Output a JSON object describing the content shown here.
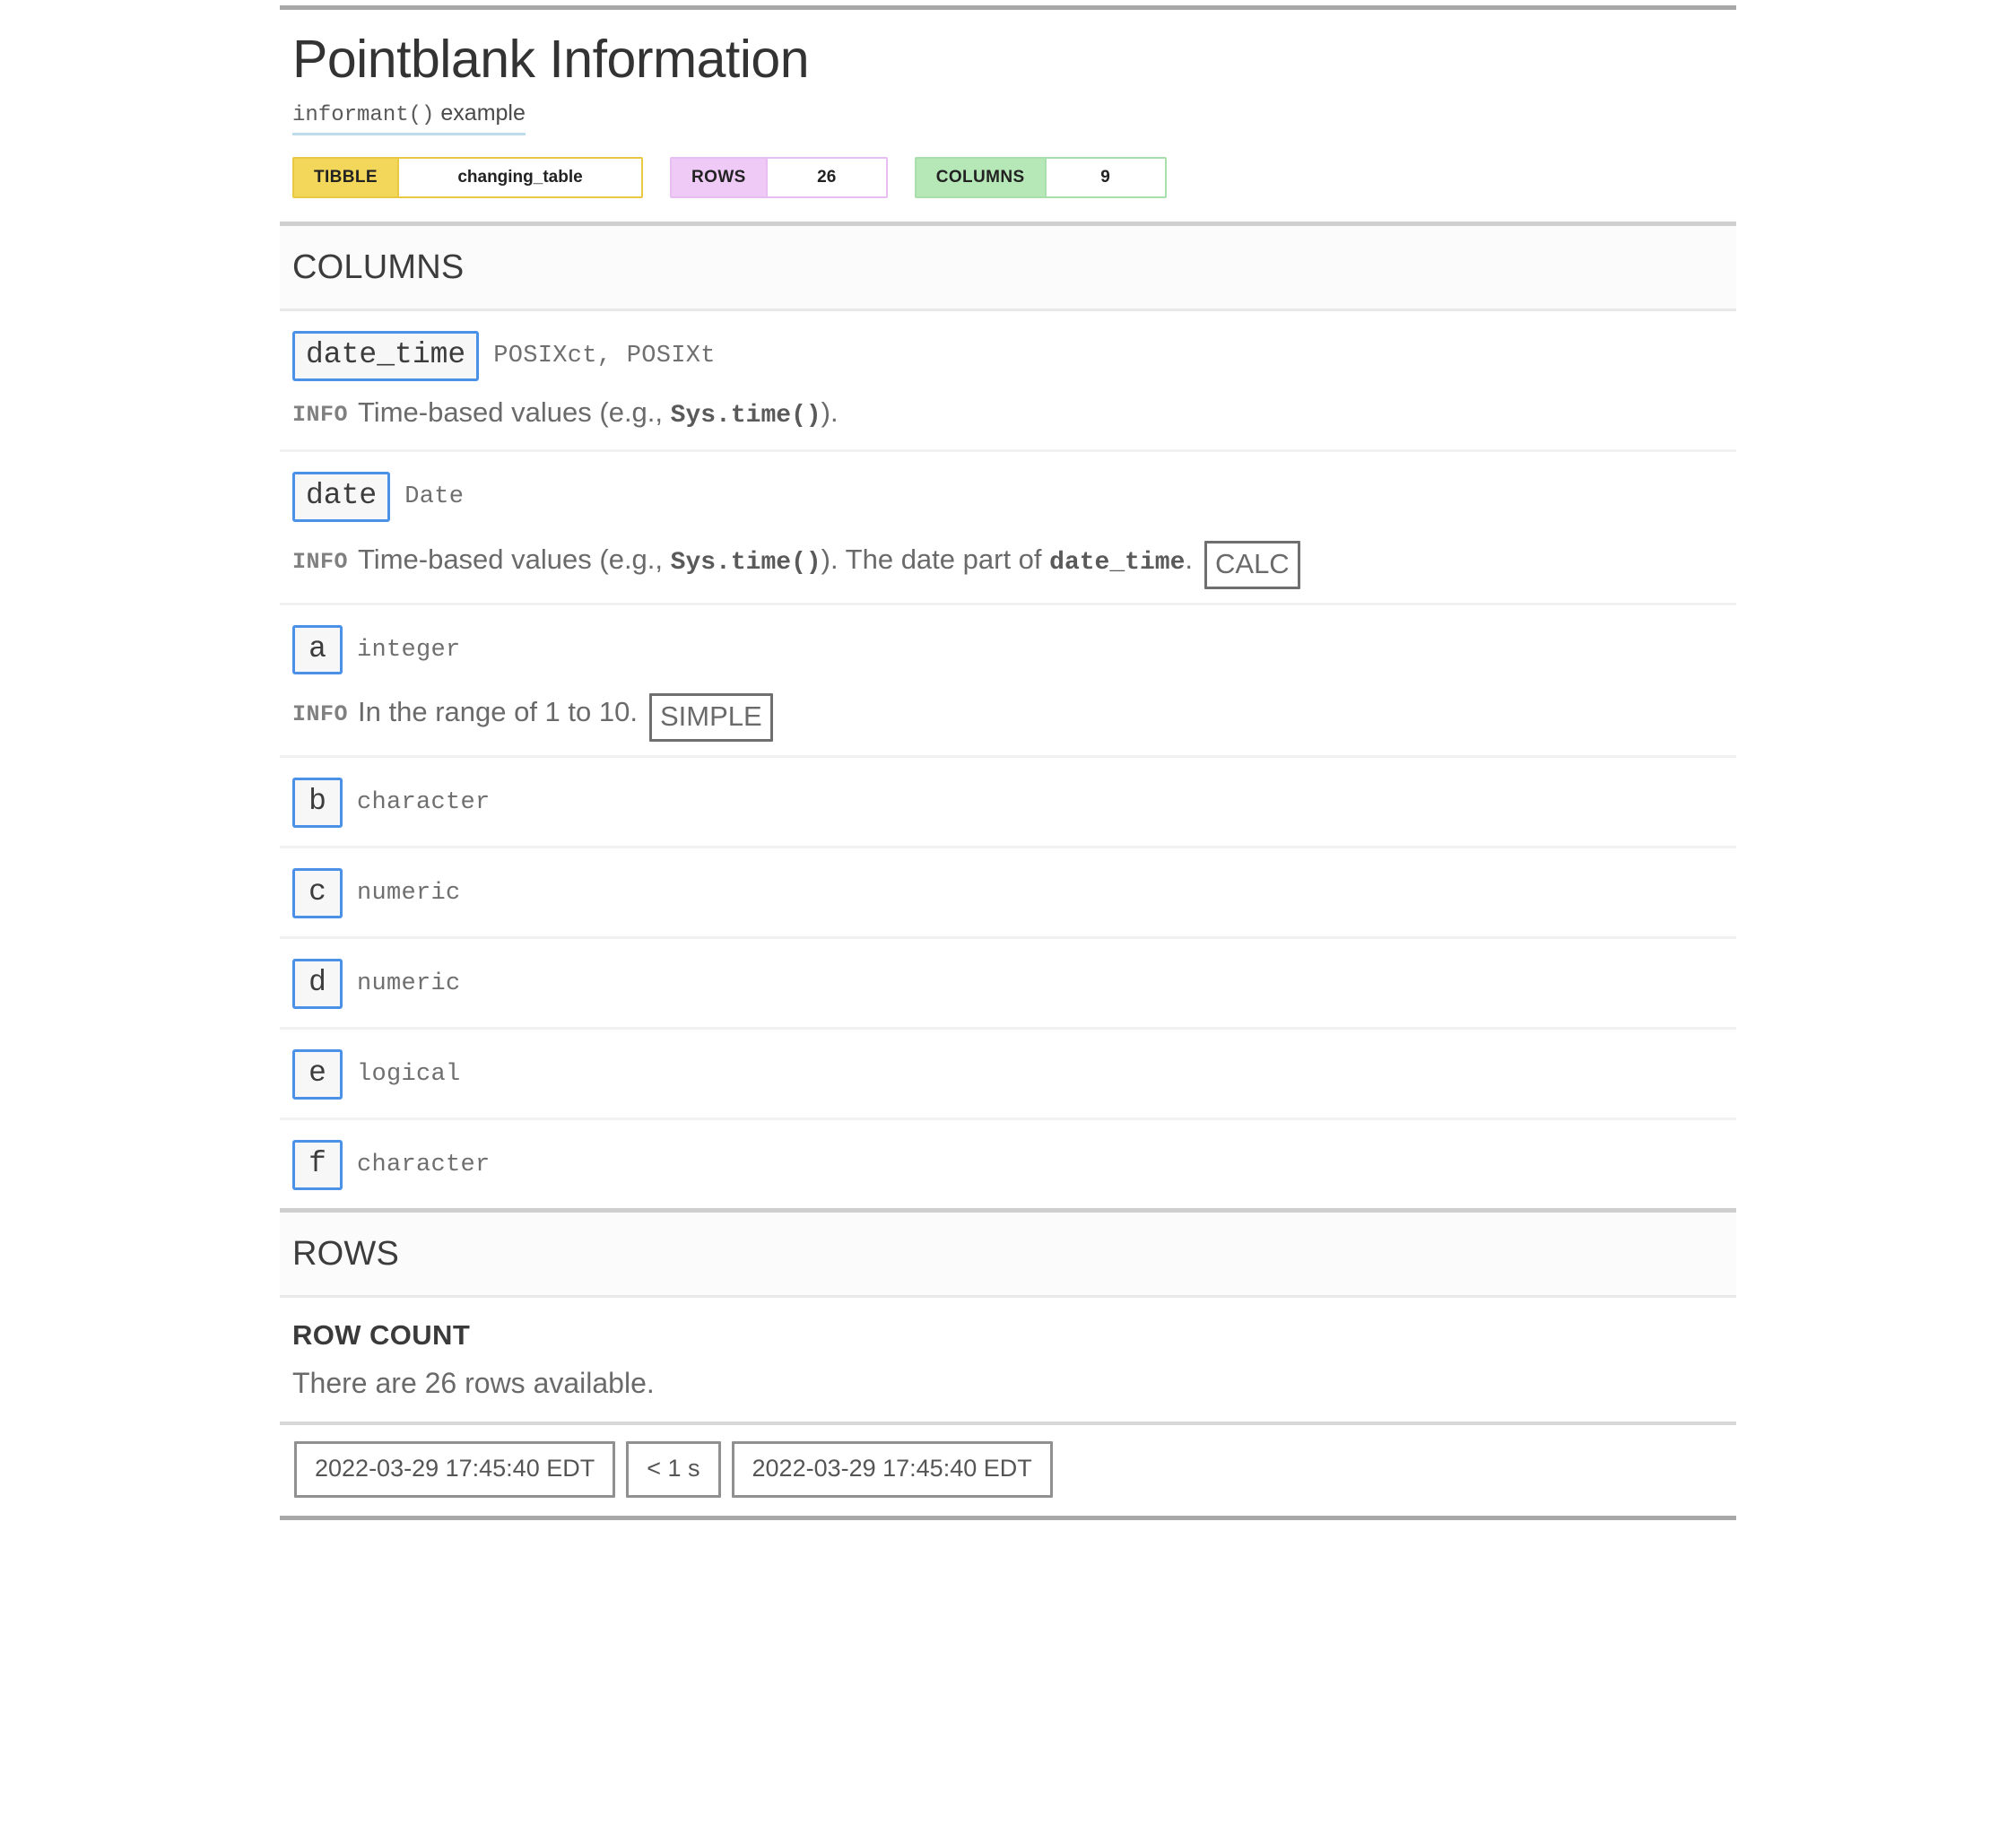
{
  "header": {
    "title": "Pointblank Information",
    "subtitle_code": "informant()",
    "subtitle_text": "example",
    "badges": [
      {
        "key": "TIBBLE",
        "value": "changing_table",
        "key_color": "#F2D75A",
        "border_color": "#E9C944"
      },
      {
        "key": "ROWS",
        "value": "26",
        "key_color": "#EFCAF7",
        "border_color": "#E8BDF2"
      },
      {
        "key": "COLUMNS",
        "value": "9",
        "key_color": "#B5E7B7",
        "border_color": "#A8DFAA"
      }
    ]
  },
  "columns_section": {
    "heading": "COLUMNS",
    "info_tag": "INFO",
    "items": [
      {
        "name": "date_time",
        "type": "POSIXct, POSIXt",
        "info_parts": [
          {
            "text": "Time-based values (e.g., ",
            "style": "plain"
          },
          {
            "text": "Sys.time()",
            "style": "code"
          },
          {
            "text": ").",
            "style": "plain"
          }
        ],
        "tag": null
      },
      {
        "name": "date",
        "type": "Date",
        "info_parts": [
          {
            "text": "Time-based values (e.g., ",
            "style": "plain"
          },
          {
            "text": "Sys.time()",
            "style": "code"
          },
          {
            "text": "). The date part of ",
            "style": "plain"
          },
          {
            "text": "date_time",
            "style": "code"
          },
          {
            "text": ".",
            "style": "plain"
          }
        ],
        "tag": "CALC"
      },
      {
        "name": "a",
        "type": "integer",
        "info_parts": [
          {
            "text": "In the range of 1 to 10.",
            "style": "plain"
          }
        ],
        "tag": "SIMPLE"
      },
      {
        "name": "b",
        "type": "character",
        "info_parts": [],
        "tag": null
      },
      {
        "name": "c",
        "type": "numeric",
        "info_parts": [],
        "tag": null
      },
      {
        "name": "d",
        "type": "numeric",
        "info_parts": [],
        "tag": null
      },
      {
        "name": "e",
        "type": "logical",
        "info_parts": [],
        "tag": null
      },
      {
        "name": "f",
        "type": "character",
        "info_parts": [],
        "tag": null
      }
    ]
  },
  "rows_section": {
    "heading": "ROWS",
    "row_count_title": "ROW COUNT",
    "row_count_text": "There are 26 rows available."
  },
  "footer": {
    "start_time": "2022-03-29 17:45:40 EDT",
    "duration": "< 1 s",
    "end_time": "2022-03-29 17:45:40 EDT"
  }
}
